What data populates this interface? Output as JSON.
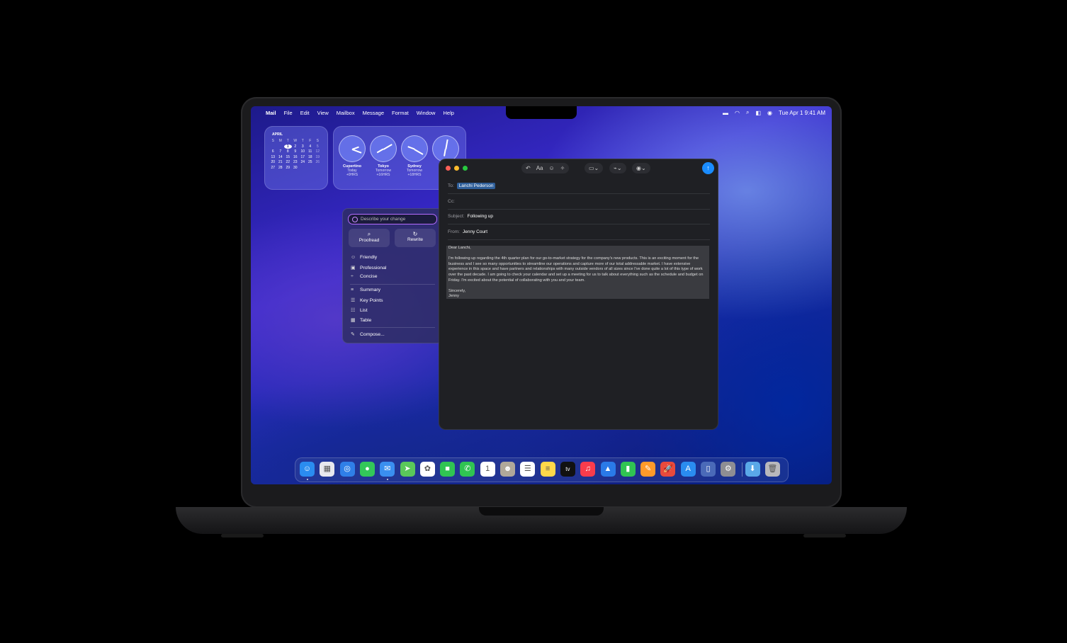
{
  "menubar": {
    "app": "Mail",
    "menus": [
      "File",
      "Edit",
      "View",
      "Mailbox",
      "Message",
      "Format",
      "Window",
      "Help"
    ],
    "datetime": "Tue Apr 1  9:41 AM"
  },
  "calendar": {
    "month": "APRIL",
    "dow": [
      "S",
      "M",
      "T",
      "W",
      "T",
      "F",
      "S"
    ],
    "rows": [
      [
        "",
        "",
        "1",
        "2",
        "3",
        "4",
        "5"
      ],
      [
        "6",
        "7",
        "8",
        "9",
        "10",
        "11",
        "12"
      ],
      [
        "13",
        "14",
        "15",
        "16",
        "17",
        "18",
        "19"
      ],
      [
        "20",
        "21",
        "22",
        "23",
        "24",
        "25",
        "26"
      ],
      [
        "27",
        "28",
        "29",
        "30",
        "",
        "",
        ""
      ]
    ],
    "today": "1"
  },
  "clocks": [
    {
      "city": "Cupertino",
      "day": "Today",
      "offset": "+0HRS"
    },
    {
      "city": "Tokyo",
      "day": "Tomorrow",
      "offset": "+16HRS"
    },
    {
      "city": "Sydney",
      "day": "Tomorrow",
      "offset": "+18HRS"
    },
    {
      "city": "",
      "day": "",
      "offset": ""
    }
  ],
  "writing_tools": {
    "placeholder": "Describe your change",
    "proofread": "Proofread",
    "rewrite": "Rewrite",
    "friendly": "Friendly",
    "professional": "Professional",
    "concise": "Concise",
    "summary": "Summary",
    "key_points": "Key Points",
    "list": "List",
    "table": "Table",
    "compose": "Compose..."
  },
  "mail": {
    "to_label": "To:",
    "to_value": "Lanchi Pederson",
    "cc_label": "Cc:",
    "subject_label": "Subject:",
    "subject_value": "Following up",
    "from_label": "From:",
    "from_value": "Jenny Court",
    "toolbar_font": "Aa",
    "greeting": "Dear Lanchi,",
    "paragraph": "I'm following up regarding the 4th quarter plan for our go-to-market strategy for the company's new products. This is an exciting moment for the business and I see so many opportunities to streamline our operations and capture more of our total addressable market. I have extensive experience in this space and have partners and relationships with many outside vendors of all sizes since I've done quite a lot of this type of work over the past decade. I am going to check your calendar and set up a meeting for us to talk about everything such as the schedule and budget on Friday. I'm excited about the potential of collaborating with you and your team.",
    "closing": "Sincerely,",
    "signature": "Jenny"
  },
  "dock": {
    "apps": [
      {
        "name": "Finder",
        "color": "#2a8cf0",
        "glyph": "☺"
      },
      {
        "name": "Launchpad",
        "color": "#e8e8ee",
        "glyph": "▦"
      },
      {
        "name": "Safari",
        "color": "#2f7fe8",
        "glyph": "◎"
      },
      {
        "name": "Messages",
        "color": "#33c759",
        "glyph": "●"
      },
      {
        "name": "Mail",
        "color": "#3a8ff0",
        "glyph": "✉"
      },
      {
        "name": "Maps",
        "color": "#5ac85a",
        "glyph": "➤"
      },
      {
        "name": "Photos",
        "color": "#ffffff",
        "glyph": "✿"
      },
      {
        "name": "FaceTime",
        "color": "#30c452",
        "glyph": "■"
      },
      {
        "name": "Phone",
        "color": "#30c452",
        "glyph": "✆"
      },
      {
        "name": "Calendar",
        "color": "#ffffff",
        "glyph": "1"
      },
      {
        "name": "Contacts",
        "color": "#b0a89a",
        "glyph": "☻"
      },
      {
        "name": "Reminders",
        "color": "#ffffff",
        "glyph": "☰"
      },
      {
        "name": "Notes",
        "color": "#ffd84a",
        "glyph": "≡"
      },
      {
        "name": "TV",
        "color": "#111111",
        "glyph": "tv"
      },
      {
        "name": "Music",
        "color": "#fa3c4c",
        "glyph": "♫"
      },
      {
        "name": "Keynote",
        "color": "#2a7ae8",
        "glyph": "▲"
      },
      {
        "name": "Numbers",
        "color": "#30c452",
        "glyph": "▮"
      },
      {
        "name": "Pages",
        "color": "#ff9a2a",
        "glyph": "✎"
      },
      {
        "name": "Rocket",
        "color": "#e84a3c",
        "glyph": "🚀"
      },
      {
        "name": "App Store",
        "color": "#2a8cf0",
        "glyph": "A"
      },
      {
        "name": "iPhone Mirroring",
        "color": "#4a6ab8",
        "glyph": "▯"
      },
      {
        "name": "System Settings",
        "color": "#8e8e93",
        "glyph": "⚙"
      },
      {
        "name": "Downloads",
        "color": "#5aa8e8",
        "glyph": "⬇"
      },
      {
        "name": "Trash",
        "color": "#b8b8bc",
        "glyph": "🗑"
      }
    ]
  }
}
